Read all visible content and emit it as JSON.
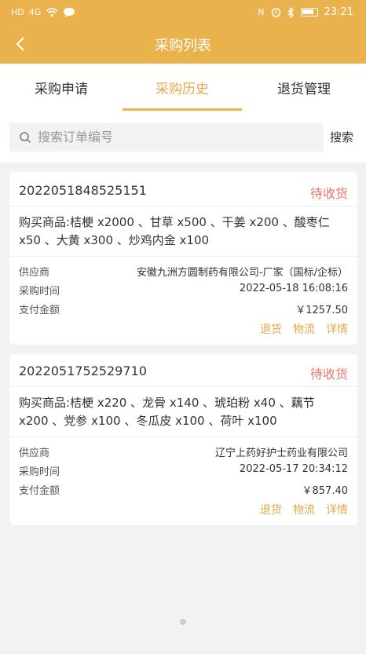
{
  "status_bar": {
    "time": "23:21",
    "left_glyphs": [
      "HD",
      "4G",
      "wifi",
      "chat"
    ],
    "right_glyphs": [
      "N",
      "alarm",
      "bt"
    ]
  },
  "header": {
    "title": "采购列表"
  },
  "tabs": [
    {
      "label": "采购申请"
    },
    {
      "label": "采购历史",
      "active": true
    },
    {
      "label": "退货管理"
    }
  ],
  "search": {
    "placeholder": "搜索订单编号",
    "button": "搜索"
  },
  "labels": {
    "supplier": "供应商",
    "purchase_time": "采购时间",
    "amount": "支付金额"
  },
  "orders": [
    {
      "order_no": "2022051848525151",
      "status": "待收货",
      "items_line1": "购买商品:桔梗 x2000 、甘草 x500 、干姜 x200 、酸枣仁",
      "items_line2": "x50 、大黄 x300 、炒鸡内金 x100",
      "supplier": "安徽九洲方圆制药有限公司-厂家（国标/企标）",
      "time": "2022-05-18 16:08:16",
      "amount": "￥1257.50",
      "actions": [
        "退货",
        "物流",
        "详情"
      ]
    },
    {
      "order_no": "2022051752529710",
      "status": "待收货",
      "items_line1": "购买商品:桔梗 x220 、龙骨 x140 、琥珀粉 x40 、藕节",
      "items_line2": "x200 、党参 x100 、冬瓜皮 x100 、荷叶 x100",
      "supplier": "辽宁上药好护士药业有限公司",
      "time": "2022-05-17 20:34:12",
      "amount": "￥857.40",
      "actions": [
        "退货",
        "物流",
        "详情"
      ]
    }
  ],
  "colors": {
    "accent": "#e9b24d",
    "status": "#e8776d",
    "action": "#e5a94a"
  }
}
